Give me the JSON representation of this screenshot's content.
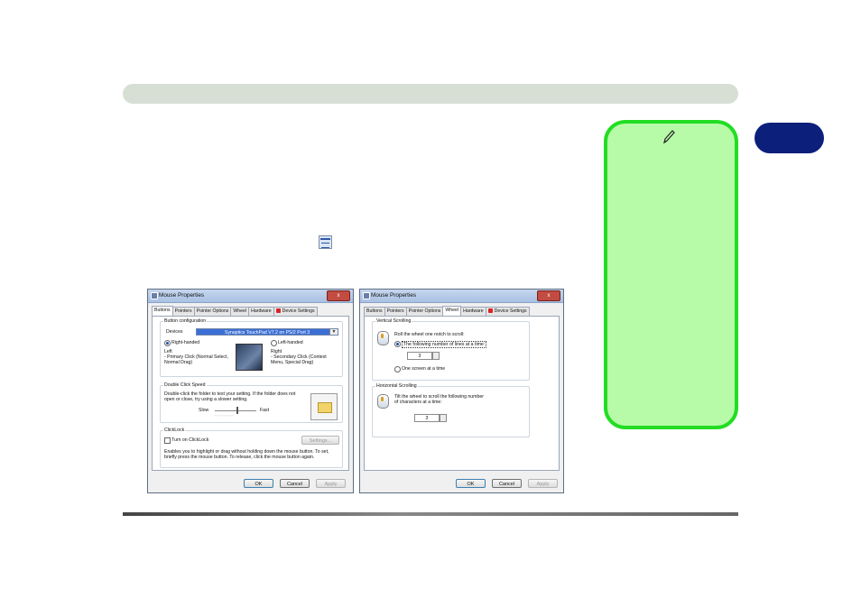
{
  "left_dialog": {
    "title": "Mouse Properties",
    "close_label": "x",
    "tabs": [
      "Buttons",
      "Pointers",
      "Pointer Options",
      "Wheel",
      "Hardware",
      "Device Settings"
    ],
    "button_config": {
      "legend": "Button configuration",
      "devices_label": "Devices",
      "devices_value": "Synaptics TouchPad V7.2 on PS/2 Port 3",
      "right_handed": "Right-handed",
      "left_handed": "Left-handed",
      "left_title": "Left",
      "left_desc_1": "- Primary Click (Normal Select,",
      "left_desc_2": "Normal Drag)",
      "right_title": "Right",
      "right_desc_1": "- Secondary Click (Context",
      "right_desc_2": "Menu, Special Drag)"
    },
    "double_click": {
      "legend": "Double Click Speed",
      "desc_1": "Double-click the folder to test your setting.  If the folder does not",
      "desc_2": "open or close, try using a slower setting.",
      "slow": "Slow",
      "fast": "Fast"
    },
    "clicklock": {
      "legend": "ClickLock",
      "checkbox_label": "Turn on ClickLock",
      "settings_button": "Settings...",
      "desc_1": "Enables you to highlight or drag without holding down the mouse button.  To set,",
      "desc_2": "briefly press the mouse button.  To release, click the mouse button again."
    },
    "buttons": {
      "ok": "OK",
      "cancel": "Cancel",
      "apply": "Apply"
    }
  },
  "right_dialog": {
    "title": "Mouse Properties",
    "close_label": "x",
    "tabs": [
      "Buttons",
      "Pointers",
      "Pointer Options",
      "Wheel",
      "Hardware",
      "Device Settings"
    ],
    "vertical": {
      "legend": "Vertical Scrolling",
      "desc": "Roll the wheel one notch to scroll:",
      "option_lines": "The following number of lines at a time:",
      "lines_value": "3",
      "option_screen": "One screen at a time"
    },
    "horizontal": {
      "legend": "Horizontal Scrolling",
      "desc_1": "Tilt the wheel to scroll the following number",
      "desc_2": "of characters at a time:",
      "chars_value": "3"
    },
    "buttons": {
      "ok": "OK",
      "cancel": "Cancel",
      "apply": "Apply"
    }
  }
}
